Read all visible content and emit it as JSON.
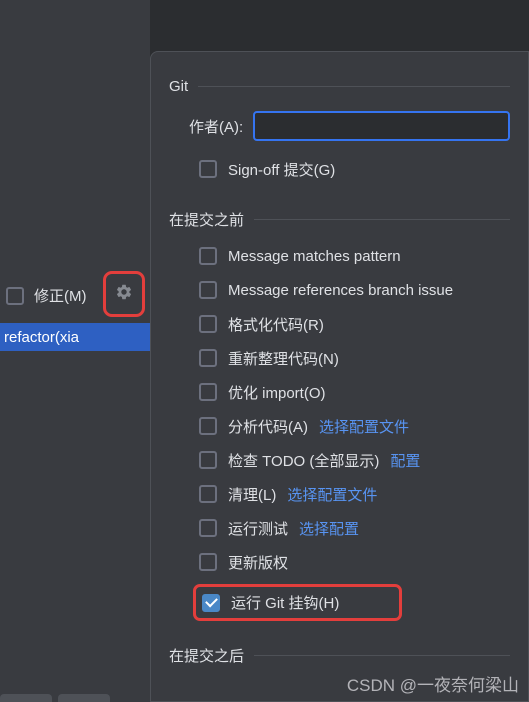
{
  "left": {
    "amend_label": "修正(M)",
    "blue_bar_text": "refactor(xia"
  },
  "popup": {
    "git_title": "Git",
    "author_label": "作者(A):",
    "author_value": "",
    "signoff_label": "Sign-off 提交(G)",
    "before_title": "在提交之前",
    "options": [
      {
        "label": "Message matches pattern",
        "checked": false
      },
      {
        "label": "Message references branch issue",
        "checked": false
      },
      {
        "label": "格式化代码(R)",
        "checked": false
      },
      {
        "label": "重新整理代码(N)",
        "checked": false
      },
      {
        "label": "优化 import(O)",
        "checked": false
      },
      {
        "label": "分析代码(A)",
        "checked": false,
        "link": "选择配置文件"
      },
      {
        "label": "检查 TODO (全部显示)",
        "checked": false,
        "link": "配置"
      },
      {
        "label": "清理(L)",
        "checked": false,
        "link": "选择配置文件"
      },
      {
        "label": "运行测试",
        "checked": false,
        "link": "选择配置"
      },
      {
        "label": "更新版权",
        "checked": false
      },
      {
        "label": "运行 Git 挂钩(H)",
        "checked": true
      }
    ],
    "after_title": "在提交之后"
  },
  "watermark": "CSDN @一夜奈何梁山"
}
